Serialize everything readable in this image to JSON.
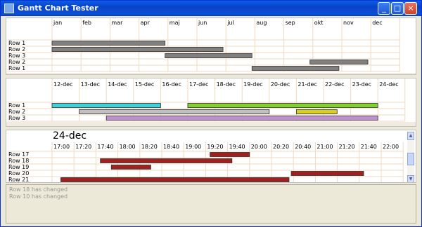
{
  "window": {
    "title": "Gantt Chart Tester",
    "minimize_glyph": "_",
    "maximize_glyph": "□",
    "close_glyph": "×"
  },
  "colors": {
    "grid": "#f0d8c0",
    "band": "#f0ece4"
  },
  "chart1": {
    "headers": [
      "jan",
      "feb",
      "mar",
      "apr",
      "maj",
      "jun",
      "jul",
      "aug",
      "sep",
      "okt",
      "nov",
      "dec"
    ],
    "rows": [
      {
        "label": "Row 1",
        "start": 0.0,
        "end": 3.9,
        "color": "#808080"
      },
      {
        "label": "Row 2",
        "start": 0.0,
        "end": 5.9,
        "color": "#808080"
      },
      {
        "label": "Row 3",
        "start": 3.9,
        "end": 6.9,
        "color": "#808080"
      },
      {
        "label": "Row 2",
        "start": 8.9,
        "end": 10.9,
        "color": "#808080"
      },
      {
        "label": "Row 1",
        "start": 6.9,
        "end": 9.9,
        "color": "#808080"
      }
    ]
  },
  "chart2": {
    "headers": [
      "12-dec",
      "13-dec",
      "14-dec",
      "15-dec",
      "16-dec",
      "17-dec",
      "18-dec",
      "19-dec",
      "20-dec",
      "21-dec",
      "22-dec",
      "23-dec",
      "24-dec"
    ],
    "rows": [
      {
        "label": "Row 1",
        "start": 0.0,
        "end": 4.0,
        "color": "#3fd0d8"
      },
      {
        "label": "Row 2",
        "start": 1.0,
        "end": 8.0,
        "color": "#c0c0c0"
      },
      {
        "label": "Row 3",
        "start": 2.0,
        "end": 12.0,
        "color": "#c090d0"
      }
    ],
    "extra_bars": [
      {
        "row": 0,
        "start": 5.0,
        "end": 12.0,
        "color": "#80d030"
      },
      {
        "row": 1,
        "start": 9.0,
        "end": 10.5,
        "color": "#d8d020"
      }
    ]
  },
  "chart3": {
    "big_date": "24-dec",
    "headers": [
      "17:00",
      "17:20",
      "17:40",
      "18:00",
      "18:20",
      "18:40",
      "19:00",
      "19:20",
      "19:40",
      "20:00",
      "20:20",
      "20:40",
      "21:00",
      "21:20",
      "21:40",
      "22:00"
    ],
    "rows": [
      {
        "label": "Row 17",
        "start": 7.2,
        "end": 9.0,
        "color": "#a02020"
      },
      {
        "label": "Row 18",
        "start": 2.2,
        "end": 8.2,
        "color": "#a02020"
      },
      {
        "label": "Row 19",
        "start": 2.7,
        "end": 4.5,
        "color": "#a02020"
      },
      {
        "label": "Row 20",
        "start": 10.9,
        "end": 14.2,
        "color": "#a02020"
      },
      {
        "label": "Row 21",
        "start": 0.4,
        "end": 10.8,
        "color": "#a02020"
      }
    ]
  },
  "log": {
    "lines": [
      "Row 18 has changed",
      "Row 10 has changed"
    ]
  }
}
